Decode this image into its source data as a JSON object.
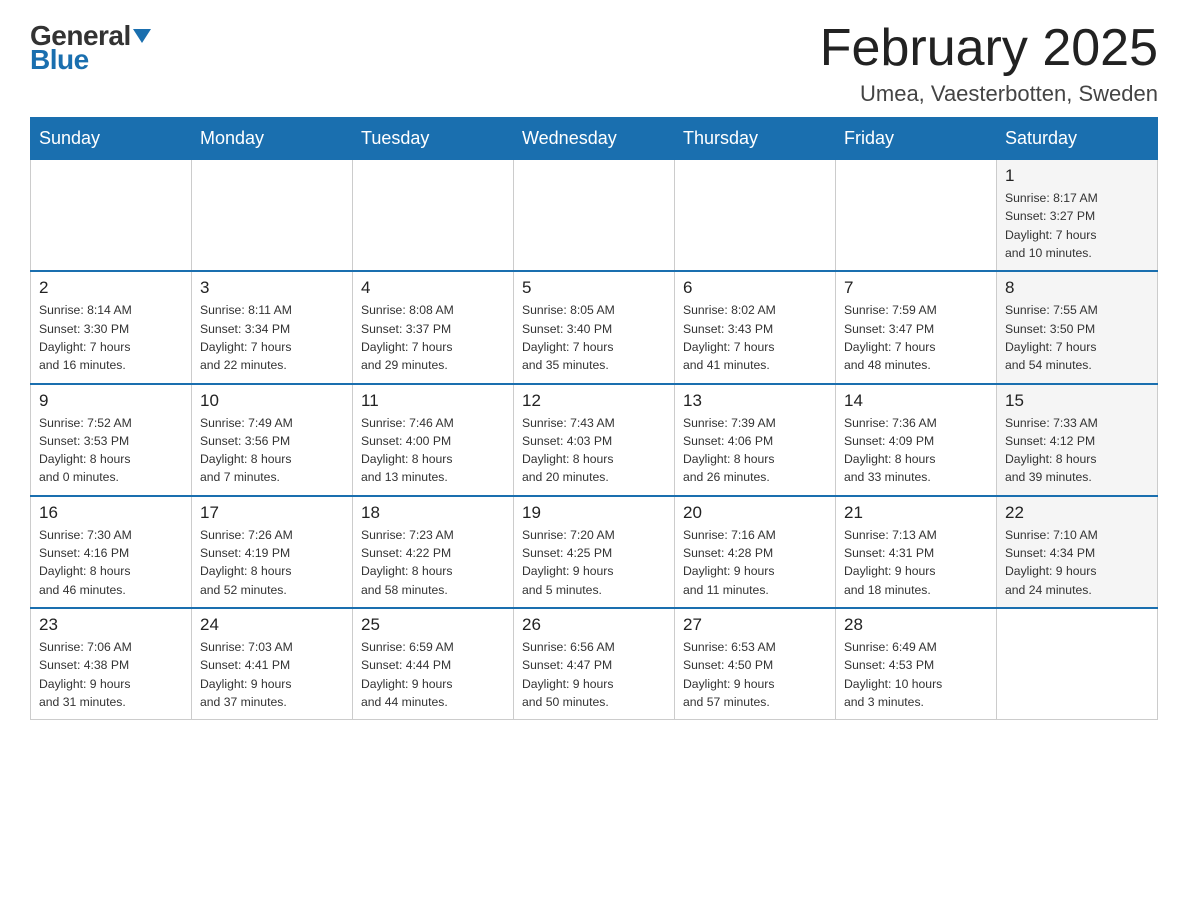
{
  "logo": {
    "general": "General",
    "blue": "Blue"
  },
  "title": "February 2025",
  "location": "Umea, Vaesterbotten, Sweden",
  "weekdays": [
    "Sunday",
    "Monday",
    "Tuesday",
    "Wednesday",
    "Thursday",
    "Friday",
    "Saturday"
  ],
  "weeks": [
    [
      {
        "day": "",
        "info": ""
      },
      {
        "day": "",
        "info": ""
      },
      {
        "day": "",
        "info": ""
      },
      {
        "day": "",
        "info": ""
      },
      {
        "day": "",
        "info": ""
      },
      {
        "day": "",
        "info": ""
      },
      {
        "day": "1",
        "info": "Sunrise: 8:17 AM\nSunset: 3:27 PM\nDaylight: 7 hours\nand 10 minutes."
      }
    ],
    [
      {
        "day": "2",
        "info": "Sunrise: 8:14 AM\nSunset: 3:30 PM\nDaylight: 7 hours\nand 16 minutes."
      },
      {
        "day": "3",
        "info": "Sunrise: 8:11 AM\nSunset: 3:34 PM\nDaylight: 7 hours\nand 22 minutes."
      },
      {
        "day": "4",
        "info": "Sunrise: 8:08 AM\nSunset: 3:37 PM\nDaylight: 7 hours\nand 29 minutes."
      },
      {
        "day": "5",
        "info": "Sunrise: 8:05 AM\nSunset: 3:40 PM\nDaylight: 7 hours\nand 35 minutes."
      },
      {
        "day": "6",
        "info": "Sunrise: 8:02 AM\nSunset: 3:43 PM\nDaylight: 7 hours\nand 41 minutes."
      },
      {
        "day": "7",
        "info": "Sunrise: 7:59 AM\nSunset: 3:47 PM\nDaylight: 7 hours\nand 48 minutes."
      },
      {
        "day": "8",
        "info": "Sunrise: 7:55 AM\nSunset: 3:50 PM\nDaylight: 7 hours\nand 54 minutes."
      }
    ],
    [
      {
        "day": "9",
        "info": "Sunrise: 7:52 AM\nSunset: 3:53 PM\nDaylight: 8 hours\nand 0 minutes."
      },
      {
        "day": "10",
        "info": "Sunrise: 7:49 AM\nSunset: 3:56 PM\nDaylight: 8 hours\nand 7 minutes."
      },
      {
        "day": "11",
        "info": "Sunrise: 7:46 AM\nSunset: 4:00 PM\nDaylight: 8 hours\nand 13 minutes."
      },
      {
        "day": "12",
        "info": "Sunrise: 7:43 AM\nSunset: 4:03 PM\nDaylight: 8 hours\nand 20 minutes."
      },
      {
        "day": "13",
        "info": "Sunrise: 7:39 AM\nSunset: 4:06 PM\nDaylight: 8 hours\nand 26 minutes."
      },
      {
        "day": "14",
        "info": "Sunrise: 7:36 AM\nSunset: 4:09 PM\nDaylight: 8 hours\nand 33 minutes."
      },
      {
        "day": "15",
        "info": "Sunrise: 7:33 AM\nSunset: 4:12 PM\nDaylight: 8 hours\nand 39 minutes."
      }
    ],
    [
      {
        "day": "16",
        "info": "Sunrise: 7:30 AM\nSunset: 4:16 PM\nDaylight: 8 hours\nand 46 minutes."
      },
      {
        "day": "17",
        "info": "Sunrise: 7:26 AM\nSunset: 4:19 PM\nDaylight: 8 hours\nand 52 minutes."
      },
      {
        "day": "18",
        "info": "Sunrise: 7:23 AM\nSunset: 4:22 PM\nDaylight: 8 hours\nand 58 minutes."
      },
      {
        "day": "19",
        "info": "Sunrise: 7:20 AM\nSunset: 4:25 PM\nDaylight: 9 hours\nand 5 minutes."
      },
      {
        "day": "20",
        "info": "Sunrise: 7:16 AM\nSunset: 4:28 PM\nDaylight: 9 hours\nand 11 minutes."
      },
      {
        "day": "21",
        "info": "Sunrise: 7:13 AM\nSunset: 4:31 PM\nDaylight: 9 hours\nand 18 minutes."
      },
      {
        "day": "22",
        "info": "Sunrise: 7:10 AM\nSunset: 4:34 PM\nDaylight: 9 hours\nand 24 minutes."
      }
    ],
    [
      {
        "day": "23",
        "info": "Sunrise: 7:06 AM\nSunset: 4:38 PM\nDaylight: 9 hours\nand 31 minutes."
      },
      {
        "day": "24",
        "info": "Sunrise: 7:03 AM\nSunset: 4:41 PM\nDaylight: 9 hours\nand 37 minutes."
      },
      {
        "day": "25",
        "info": "Sunrise: 6:59 AM\nSunset: 4:44 PM\nDaylight: 9 hours\nand 44 minutes."
      },
      {
        "day": "26",
        "info": "Sunrise: 6:56 AM\nSunset: 4:47 PM\nDaylight: 9 hours\nand 50 minutes."
      },
      {
        "day": "27",
        "info": "Sunrise: 6:53 AM\nSunset: 4:50 PM\nDaylight: 9 hours\nand 57 minutes."
      },
      {
        "day": "28",
        "info": "Sunrise: 6:49 AM\nSunset: 4:53 PM\nDaylight: 10 hours\nand 3 minutes."
      },
      {
        "day": "",
        "info": ""
      }
    ]
  ]
}
